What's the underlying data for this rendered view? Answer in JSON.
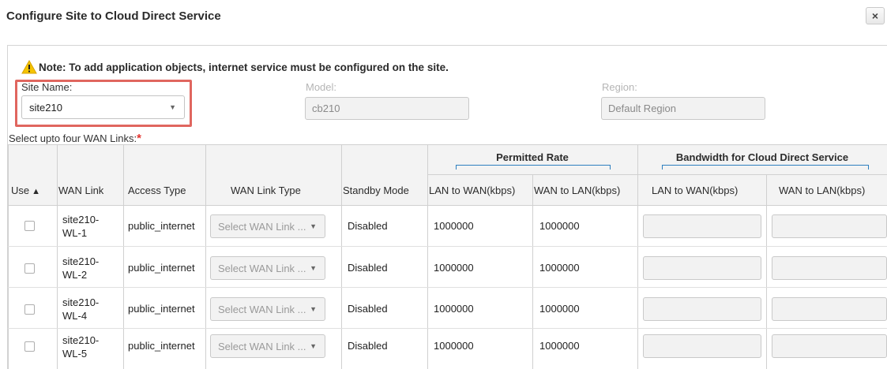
{
  "dialog": {
    "title": "Configure Site to Cloud Direct Service",
    "close_label": "×"
  },
  "note": {
    "text": "Note: To add application objects, internet service must be configured on the site."
  },
  "form": {
    "site_name_label": "Site Name:",
    "site_name_value": "site210",
    "model_label": "Model:",
    "model_value": "cb210",
    "region_label": "Region:",
    "region_value": "Default Region",
    "wan_links_label": "Select upto four WAN Links:",
    "required_mark": "*"
  },
  "table": {
    "group_headers": {
      "permitted_rate": "Permitted Rate",
      "bandwidth_cds": "Bandwidth for Cloud Direct Service"
    },
    "columns": {
      "use": "Use",
      "wan_link": "WAN Link",
      "access_type": "Access Type",
      "wan_link_type": "WAN Link Type",
      "standby_mode": "Standby Mode",
      "permitted_lan_to_wan": "LAN to WAN(kbps)",
      "permitted_wan_to_lan": "WAN to LAN(kbps)",
      "bandwidth_lan_to_wan": "LAN to WAN(kbps)",
      "bandwidth_wan_to_lan": "WAN to LAN(kbps)"
    },
    "rows": [
      {
        "wan_link_l1": "site210-",
        "wan_link_l2": "WL-1",
        "access_type": "public_internet",
        "wan_link_type_placeholder": "Select WAN Link ...",
        "standby_mode": "Disabled",
        "lan_to_wan": "1000000",
        "wan_to_lan": "1000000",
        "checked": false
      },
      {
        "wan_link_l1": "site210-",
        "wan_link_l2": "WL-2",
        "access_type": "public_internet",
        "wan_link_type_placeholder": "Select WAN Link ...",
        "standby_mode": "Disabled",
        "lan_to_wan": "1000000",
        "wan_to_lan": "1000000",
        "checked": false
      },
      {
        "wan_link_l1": "site210-",
        "wan_link_l2": "WL-4",
        "access_type": "public_internet",
        "wan_link_type_placeholder": "Select WAN Link ...",
        "standby_mode": "Disabled",
        "lan_to_wan": "1000000",
        "wan_to_lan": "1000000",
        "checked": false
      },
      {
        "wan_link_l1": "site210-",
        "wan_link_l2": "WL-5",
        "access_type": "public_internet",
        "wan_link_type_placeholder": "Select WAN Link ...",
        "standby_mode": "Disabled",
        "lan_to_wan": "1000000",
        "wan_to_lan": "1000000",
        "checked": false
      }
    ]
  },
  "colors": {
    "highlight_border": "#e0665f",
    "required_star": "#e3342f",
    "bracket_blue": "#2d7fbf",
    "warning_yellow": "#f5c400"
  },
  "icons": {
    "warning": "warning-icon",
    "sort": "sort-ascending-icon",
    "dropdown": "chevron-down-icon",
    "close": "close-icon"
  }
}
